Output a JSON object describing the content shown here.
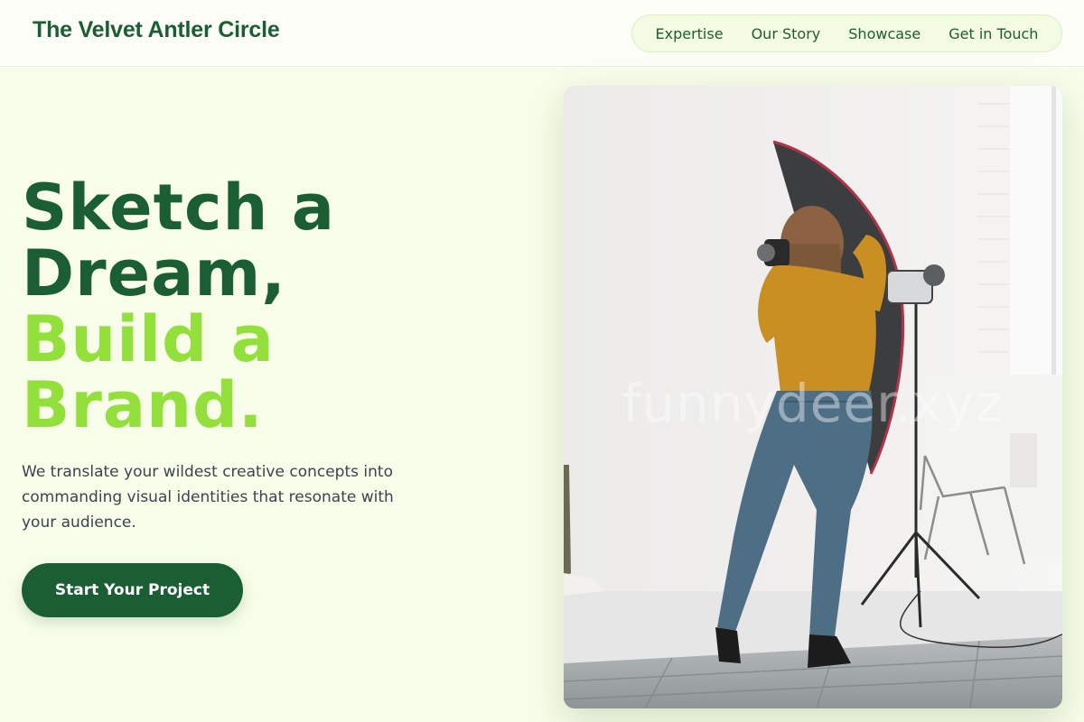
{
  "header": {
    "brand": "The Velvet Antler Circle",
    "nav": [
      "Expertise",
      "Our Story",
      "Showcase",
      "Get in Touch"
    ]
  },
  "hero": {
    "title_dark": [
      "Sketch a",
      "Dream,"
    ],
    "title_light": [
      "Build a",
      "Brand."
    ],
    "subtitle": "We translate your wildest creative concepts into commanding visual identities that resonate with your audience.",
    "cta": "Start Your Project"
  },
  "photo": {
    "alt": "Photographer in a white studio",
    "watermark": "funnydeer.xyz"
  },
  "colors": {
    "accent_dark": "#1b5e33",
    "accent_light": "#93e03c",
    "background": "#f7fde9"
  }
}
